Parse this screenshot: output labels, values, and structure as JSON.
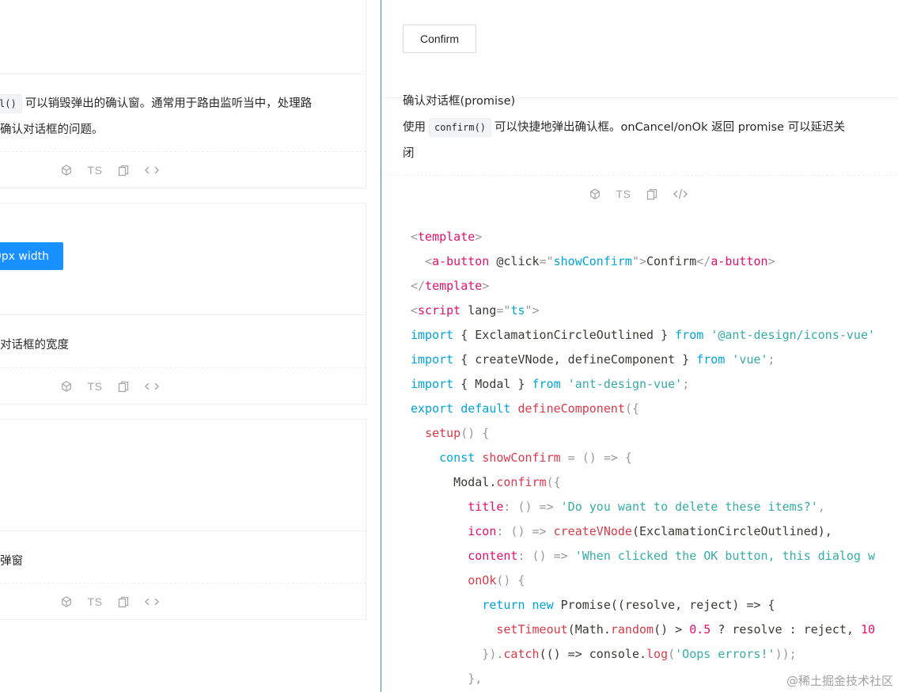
{
  "left": {
    "card1": {
      "desc_line1_code": "l()",
      "desc_line1_text": "可以销毁弹出的确认窗。通常用于路由监听当中，处理路",
      "desc_line2": "确认对话框的问题。"
    },
    "card2": {
      "button_label": "0px width",
      "desc": "对话框的宽度"
    },
    "card3": {
      "desc": "弹窗"
    },
    "actions": {
      "ts_label": "TS",
      "codepen_icon": "codesandbox-icon",
      "copy_icon": "copy-icon",
      "code_icon": "code-icon"
    }
  },
  "right": {
    "confirm_button": "Confirm",
    "title": "确认对话框(promise)",
    "desc_prefix": "使用",
    "desc_code": "confirm()",
    "desc_suffix": "可以快捷地弹出确认框。onCancel/onOk 返回 promise 可以延迟关",
    "desc_line2": "闭",
    "actions": {
      "ts_label": "TS"
    }
  },
  "code": {
    "l1": {
      "a": "<",
      "b": "template",
      "c": ">"
    },
    "l2": {
      "a": "  <",
      "b": "a-button",
      "c": " @click",
      "d": "=",
      "e": "\"",
      "f": "showConfirm",
      "g": "\"",
      "h": ">",
      "i": "Confirm",
      "j": "</",
      "k": "a-button",
      "l": ">"
    },
    "l3": {
      "a": "</",
      "b": "template",
      "c": ">"
    },
    "l4": {
      "a": "<",
      "b": "script",
      "c": " lang",
      "d": "=",
      "e": "\"",
      "f": "ts",
      "g": "\"",
      "h": ">"
    },
    "l5": {
      "a": "import",
      "b": " { ExclamationCircleOutlined } ",
      "c": "from",
      "d": " ",
      "e": "'@ant-design/icons-vue'"
    },
    "l6": {
      "a": "import",
      "b": " { createVNode, defineComponent } ",
      "c": "from",
      "d": " ",
      "e": "'vue'",
      "f": ";"
    },
    "l7": {
      "a": "import",
      "b": " { Modal } ",
      "c": "from",
      "d": " ",
      "e": "'ant-design-vue'",
      "f": ";"
    },
    "l8": {
      "a": "export",
      "b": " ",
      "c": "default",
      "d": " ",
      "e": "defineComponent",
      "f": "({"
    },
    "l9": {
      "a": "  ",
      "b": "setup",
      "c": "() {"
    },
    "l10": {
      "a": "    ",
      "b": "const",
      "c": " ",
      "d": "showConfirm",
      "e": " = () => {"
    },
    "l11": {
      "a": "      Modal.",
      "b": "confirm",
      "c": "({"
    },
    "l12": {
      "a": "        ",
      "b": "title",
      "c": ": () => ",
      "d": "'Do you want to delete these items?'",
      "e": ","
    },
    "l13": {
      "a": "        ",
      "b": "icon",
      "c": ": () => ",
      "d": "createVNode",
      "e": "(ExclamationCircleOutlined),"
    },
    "l14": {
      "a": "        ",
      "b": "content",
      "c": ": () => ",
      "d": "'When clicked the OK button, this dialog w"
    },
    "l15": {
      "a": "        ",
      "b": "onOk",
      "c": "() {"
    },
    "l16": {
      "a": "          ",
      "b": "return",
      "c": " ",
      "d": "new",
      "e": " Promise((resolve, reject) => {"
    },
    "l17": {
      "a": "            ",
      "b": "setTimeout",
      "c": "(Math.",
      "d": "random",
      "e": "() > ",
      "f": "0.5",
      "g": " ? resolve : reject, ",
      "h": "10"
    },
    "l18": {
      "a": "          }).",
      "b": "catch",
      "c": "(() => console.",
      "d": "log",
      "e": "(",
      "f": "'Oops errors!'",
      "g": "));"
    },
    "l19": {
      "a": "        },"
    }
  },
  "watermark": "@稀土掘金技术社区"
}
